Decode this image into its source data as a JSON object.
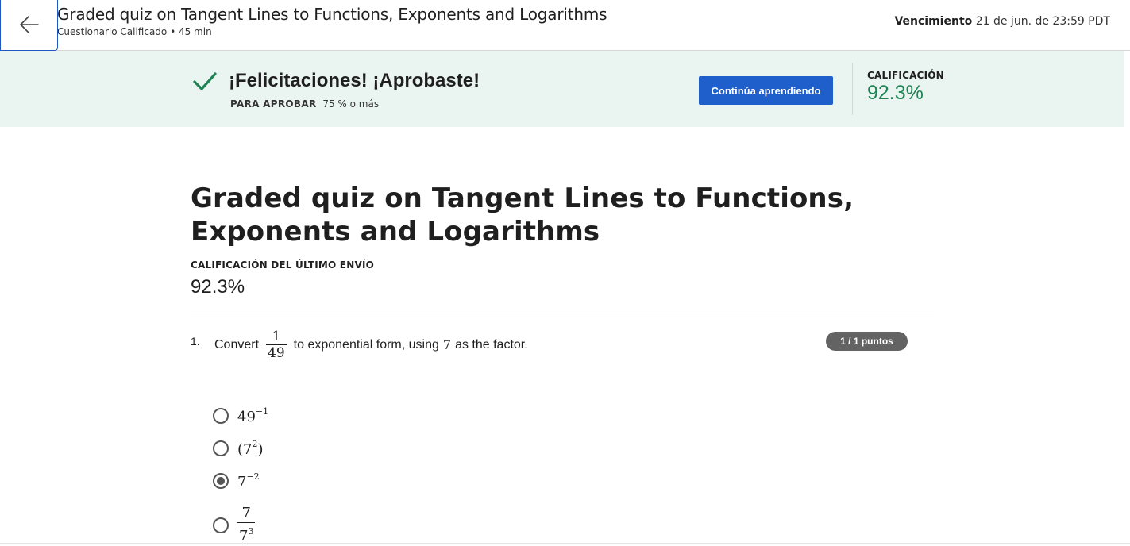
{
  "header": {
    "title": "Graded quiz on Tangent Lines to Functions, Exponents and Logarithms",
    "subtitle": "Cuestionario Calificado • 45 min",
    "due_label": "Vencimiento",
    "due_value": "21 de jun. de 23:59 PDT",
    "back_icon": "arrow-left-icon"
  },
  "banner": {
    "icon": "checkmark-icon",
    "message": "¡Felicitaciones! ¡Aprobaste!",
    "pass_label": "PARA APROBAR",
    "pass_value": "75 % o más",
    "continue_button": "Continúa aprendiendo",
    "grade_label": "CALIFICACIÓN",
    "grade_value": "92.3%",
    "background_color": "#eaf5f2",
    "grade_color": "#1f8354",
    "button_color": "#1f5fcc"
  },
  "main": {
    "title": "Graded quiz on Tangent Lines to Functions, Exponents and Logarithms",
    "last_grade_label": "CALIFICACIÓN DEL ÚLTIMO ENVÍO",
    "last_grade_value": "92.3%"
  },
  "question": {
    "number": "1.",
    "text_before": "Convert",
    "fraction_num": "1",
    "fraction_den": "49",
    "text_middle": "to exponential form, using",
    "factor": "7",
    "text_after": "as the factor.",
    "points": "1 / 1 puntos",
    "options": [
      {
        "base": "49",
        "exp": "−1",
        "selected": false
      },
      {
        "open": "(",
        "base": "7",
        "exp": "2",
        "close": ")",
        "selected": false
      },
      {
        "base": "7",
        "exp": "−2",
        "selected": true
      },
      {
        "num": "7",
        "den_base": "7",
        "den_exp": "3",
        "selected": false
      }
    ]
  }
}
